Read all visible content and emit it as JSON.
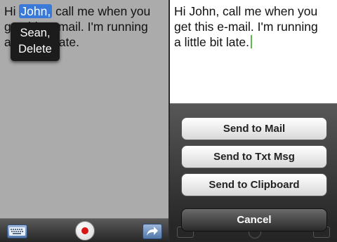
{
  "dictation": {
    "line1_before": "Hi ",
    "selected_word": "John,",
    "line1_after": " call me when you",
    "line2": "get this e-mail. I'm running",
    "line3": "a little bit late."
  },
  "correction_popup": {
    "items": [
      {
        "label": "Sean,"
      },
      {
        "label": "Delete"
      }
    ]
  },
  "left_toolbar": {
    "icons": [
      "keyboard-icon",
      "record-icon",
      "share-icon"
    ],
    "record_color": "#d81515"
  },
  "message": {
    "line1": "Hi John, call me when you",
    "line2": "get this e-mail. I'm running",
    "line3": "a little bit late."
  },
  "action_sheet": {
    "buttons": [
      {
        "label": "Send to Mail"
      },
      {
        "label": "Send to Txt Msg"
      },
      {
        "label": "Send to Clipboard"
      }
    ],
    "cancel_label": "Cancel"
  },
  "colors": {
    "selection": "#3a79d8",
    "caret": "#5fb84d"
  }
}
